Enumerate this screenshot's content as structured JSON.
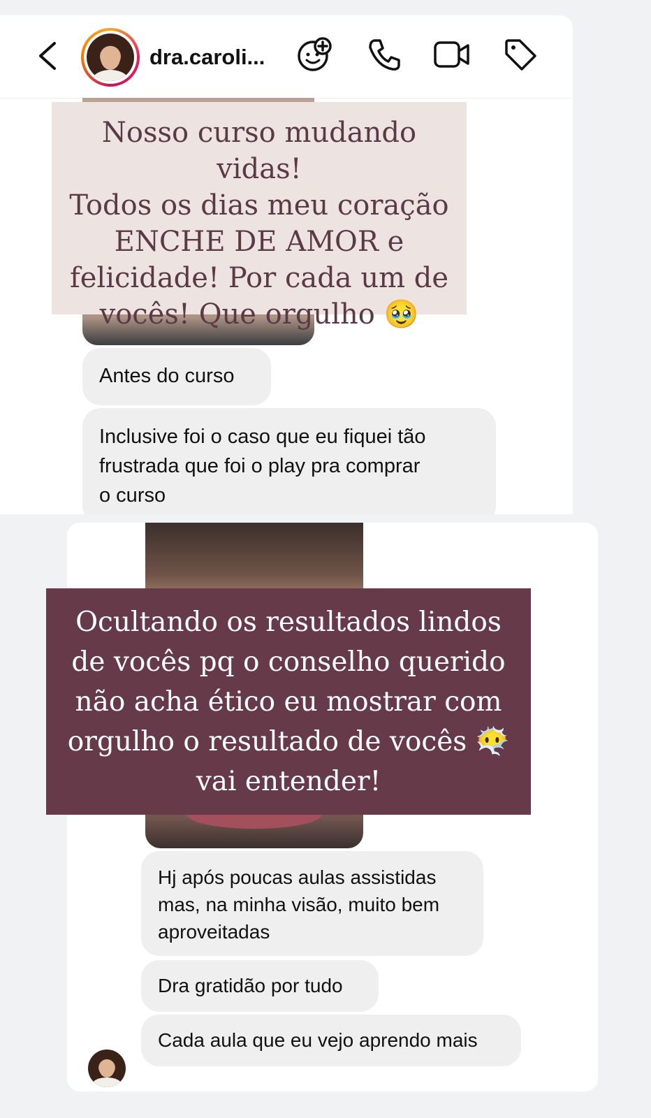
{
  "header": {
    "username": "dra.caroli...",
    "icons": [
      "back-icon",
      "sticker-add-icon",
      "phone-icon",
      "video-icon",
      "tag-icon"
    ]
  },
  "story_top": {
    "caption_lines": [
      "Nosso curso mudando vidas!",
      "Todos os dias meu coração",
      "ENCHE DE AMOR e",
      "felicidade! Por cada um de",
      "vocês! Que orgulho 🥹"
    ]
  },
  "messages_top": [
    {
      "lines": [
        "Antes do curso"
      ]
    },
    {
      "lines": [
        "Inclusive foi o caso que eu fiquei tão",
        "frustrada que foi o play pra comprar",
        "o curso"
      ]
    }
  ],
  "story_bottom": {
    "caption_lines": [
      "Ocultando os resultados lindos",
      "de vocês pq o conselho querido",
      "não acha ético eu mostrar com",
      "orgulho o resultado de vocês 😶‍🌫️",
      "vai entender!"
    ]
  },
  "messages_bottom": [
    {
      "lines": [
        "Hj após poucas aulas assistidas",
        "mas, na minha visão, muito bem",
        "aproveitadas"
      ]
    },
    {
      "lines": [
        "Dra gratidão por tudo"
      ]
    },
    {
      "lines": [
        "Cada aula que eu vejo aprendo mais"
      ]
    }
  ],
  "colors": {
    "overlay_top_bg": "#ede3e1",
    "overlay_top_text": "#5b3a48",
    "overlay_bottom_bg": "#663a48",
    "bubble_bg": "#efefef"
  }
}
